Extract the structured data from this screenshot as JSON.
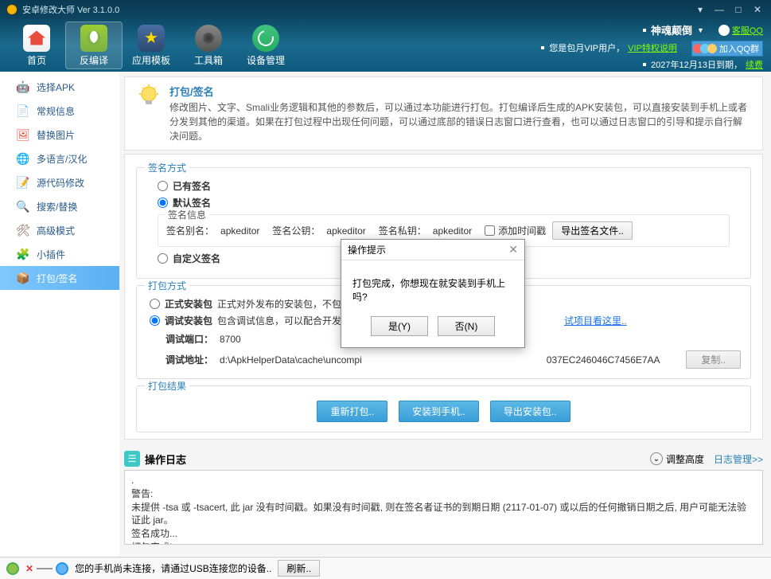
{
  "app": {
    "title": "安卓修改大师 Ver 3.1.0.0"
  },
  "window_controls": {
    "dropdown": "▾",
    "min": "—",
    "max": "□",
    "close": "✕"
  },
  "nav": [
    {
      "label": "首页"
    },
    {
      "label": "反编译"
    },
    {
      "label": "应用模板"
    },
    {
      "label": "工具箱"
    },
    {
      "label": "设备管理"
    }
  ],
  "user": {
    "name": "神魂颠倒",
    "vip_text": "您是包月VIP用户，",
    "vip_link": "VIP特权说明",
    "expire_text": "2027年12月13日到期，",
    "renew_link": "续费",
    "qq_service": "客服QQ",
    "qq_group": "加入QQ群"
  },
  "sidebar": {
    "items": [
      {
        "label": "选择APK",
        "icon": "🤖",
        "color": "#8bc34a"
      },
      {
        "label": "常规信息",
        "icon": "📄",
        "color": "#ff9800"
      },
      {
        "label": "替换图片",
        "icon": "🖼",
        "color": "#f44336"
      },
      {
        "label": "多语言/汉化",
        "icon": "🌐",
        "color": "#4caf50"
      },
      {
        "label": "源代码修改",
        "icon": "📝",
        "color": "#2196f3"
      },
      {
        "label": "搜索/替换",
        "icon": "🔍",
        "color": "#03a9f4"
      },
      {
        "label": "高级模式",
        "icon": "🛠",
        "color": "#795548"
      },
      {
        "label": "小插件",
        "icon": "🧩",
        "color": "#00bcd4"
      },
      {
        "label": "打包/签名",
        "icon": "📦",
        "color": "#ff9800"
      }
    ]
  },
  "intro": {
    "title": "打包/签名",
    "desc": "修改图片、文字、Smali业务逻辑和其他的参数后，可以通过本功能进行打包。打包编译后生成的APK安装包，可以直接安装到手机上或者分发到其他的渠道。如果在打包过程中出现任何问题，可以通过底部的错误日志窗口进行查看，也可以通过日志窗口的引导和提示自行解决问题。"
  },
  "sign": {
    "legend": "签名方式",
    "opt_existing": "已有签名",
    "opt_default": "默认签名",
    "opt_custom": "自定义签名",
    "info_legend": "签名信息",
    "alias_label": "签名别名：",
    "alias_value": "apkeditor",
    "pub_label": "签名公钥：",
    "pub_value": "apkeditor",
    "priv_label": "签名私钥：",
    "priv_value": "apkeditor",
    "timestamp_label": "添加时间戳",
    "export_btn": "导出签名文件.."
  },
  "pkg": {
    "legend": "打包方式",
    "opt_release": "正式安装包",
    "opt_release_desc": "正式对外发布的安装包，不包含调试信",
    "opt_debug": "调试安装包",
    "opt_debug_desc": "包含调试信息，可以配合开发工具进行",
    "opt_debug_link": "试项目看这里..",
    "port_label": "调试端口：",
    "port_value": "8700",
    "addr_label": "调试地址：",
    "addr_value_prefix": "d:\\ApkHelperData\\cache\\uncompi",
    "addr_value_suffix": "037EC246046C7456E7AA",
    "copy_btn": "复制.."
  },
  "result": {
    "legend": "打包结果",
    "repack_btn": "重新打包..",
    "install_btn": "安装到手机..",
    "export_btn": "导出安装包.."
  },
  "log": {
    "title": "操作日志",
    "adjust": "调整高度",
    "manage": "日志管理>>",
    "lines": [
      ".",
      "警告:",
      "未提供 -tsa 或 -tsacert, 此 jar 没有时间戳。如果没有时间戳, 则在签名者证书的到期日期 (2117-01-07) 或以后的任何撤销日期之后, 用户可能无法验证此 jar。",
      "签名成功...",
      "打包完成!"
    ]
  },
  "status": {
    "text": "您的手机尚未连接，请通过USB连接您的设备..",
    "refresh": "刷新.."
  },
  "dialog": {
    "title": "操作提示",
    "message": "打包完成，你想现在就安装到手机上吗?",
    "yes": "是(Y)",
    "no": "否(N)"
  }
}
